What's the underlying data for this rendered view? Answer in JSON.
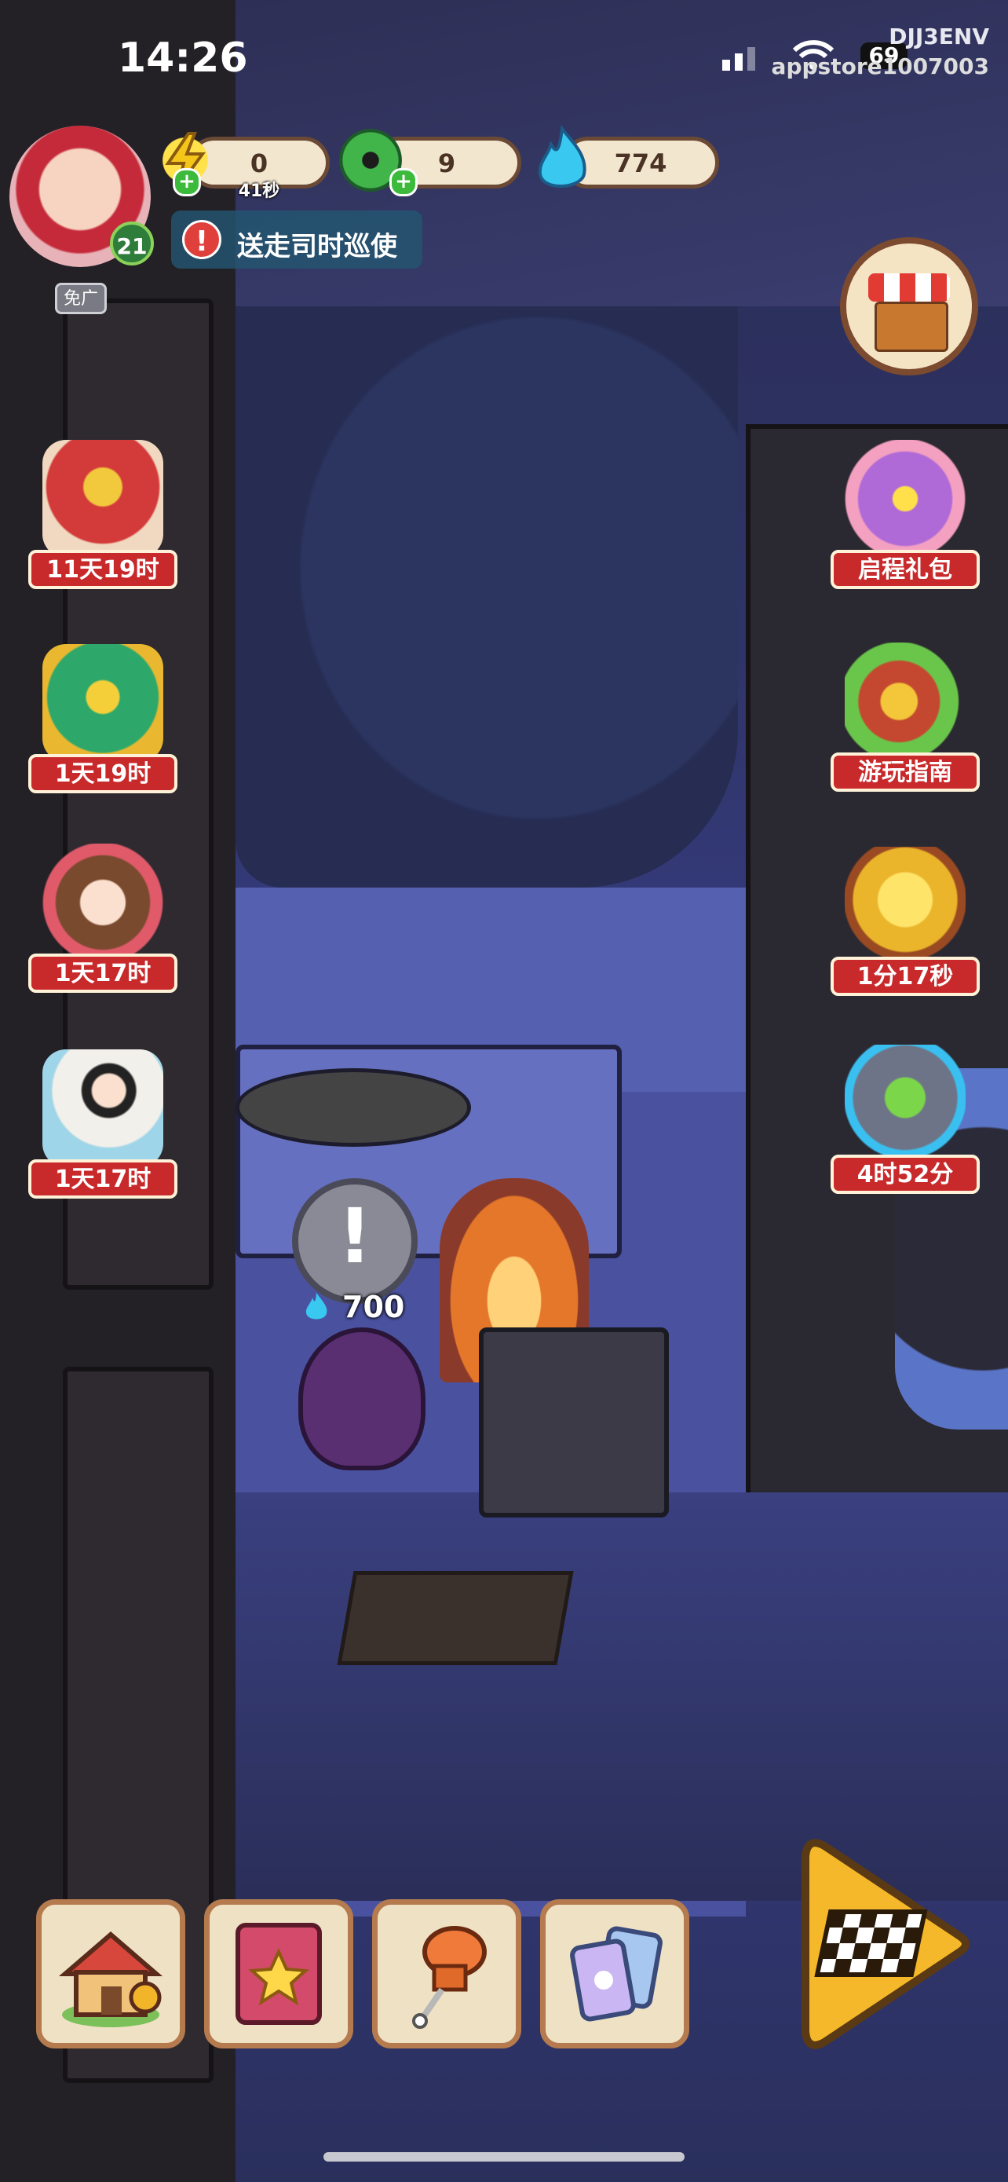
{
  "status_bar": {
    "time": "14:26",
    "carrier_line1": "DJJ3ENV",
    "carrier_line2": "appstore1007003",
    "battery": "69"
  },
  "resources": {
    "energy": {
      "value": "0",
      "timer": "41秒",
      "icon": "lightning-icon"
    },
    "jade": {
      "value": "9",
      "icon": "jade-coin-icon"
    },
    "spirit_flame": {
      "value": "774",
      "icon": "blue-flame-icon"
    }
  },
  "player": {
    "level": "21",
    "no_ads_label": "免广"
  },
  "quest": {
    "alert_icon": "!",
    "text": "送走司时巡使"
  },
  "left_events": [
    {
      "label": "11天19时",
      "icon": "red-envelope-gift-icon"
    },
    {
      "label": "1天19时",
      "icon": "jade-treasure-chest-icon"
    },
    {
      "label": "1天17时",
      "icon": "girl-character-icon"
    },
    {
      "label": "1天17时",
      "icon": "boy-character-icon"
    }
  ],
  "right_events": [
    {
      "label": "启程礼包",
      "icon": "gift-box-icon"
    },
    {
      "label": "游玩指南",
      "icon": "treasure-guide-icon"
    },
    {
      "label": "1分17秒",
      "icon": "gold-chest-icon"
    },
    {
      "label": "4时52分",
      "icon": "green-plus-orb-icon"
    }
  ],
  "scene": {
    "reward_value": "700"
  },
  "colors": {
    "label_red": "#c8292b",
    "panel_cream": "#efe2c4",
    "panel_border": "#b57a4e",
    "night_blue": "#3b4390"
  },
  "bottom_nav": [
    {
      "name": "home-button",
      "icon": "house-pin-icon"
    },
    {
      "name": "book-button",
      "icon": "star-book-icon"
    },
    {
      "name": "pin-button",
      "icon": "orange-pin-icon"
    },
    {
      "name": "cards-button",
      "icon": "cards-icon"
    }
  ]
}
